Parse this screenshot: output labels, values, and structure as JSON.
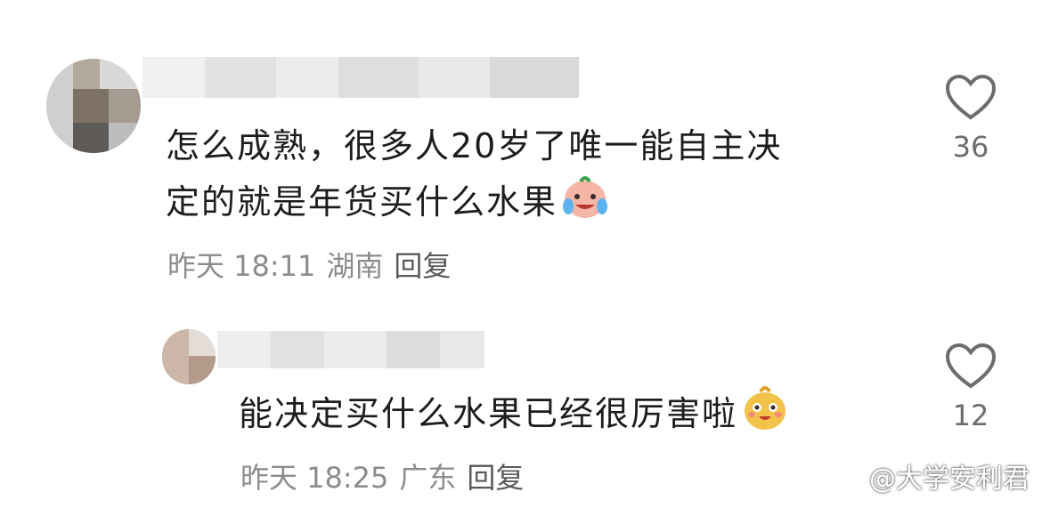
{
  "comments": [
    {
      "text_line1": "怎么成熟，很多人20岁了唯一能自主决",
      "text_line2": "定的就是年货买什么水果",
      "emoji": "crying-laughing-emoji",
      "time": "昨天 18:11",
      "location": "湖南",
      "reply": "回复",
      "likes": "36"
    },
    {
      "text_line1": "能决定买什么水果已经很厉害啦",
      "emoji": "smiling-emoji",
      "time": "昨天 18:25",
      "location": "广东",
      "reply": "回复",
      "likes": "12"
    }
  ],
  "watermark": "@大学安利君",
  "icons": {
    "like": "heart-icon",
    "watermark_logo": "weibo-icon"
  }
}
